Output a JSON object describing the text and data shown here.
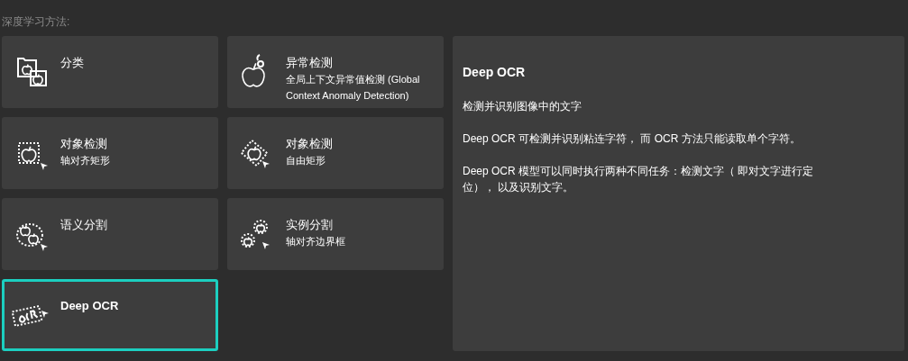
{
  "heading": "深度学习方法:",
  "methods": [
    {
      "kind": "classify",
      "title": "分类",
      "selected": false
    },
    {
      "kind": "anomaly",
      "title": "异常检测",
      "subtitle": "全局上下文异常值检测 (Global Context Anomaly Detection)",
      "selected": false
    },
    {
      "kind": "bbox",
      "title": "对象检测",
      "subtitle": "轴对齐矩形",
      "selected": false
    },
    {
      "kind": "rotated",
      "title": "对象检测",
      "subtitle": "自由矩形",
      "selected": false
    },
    {
      "kind": "semantic",
      "title": "语义分割",
      "selected": false
    },
    {
      "kind": "instance",
      "title": "实例分割",
      "subtitle": "轴对齐边界框",
      "selected": false
    },
    {
      "kind": "ocr",
      "title": "Deep OCR",
      "selected": true
    }
  ],
  "detail": {
    "title": "Deep OCR",
    "paragraphs": [
      "检测并识别图像中的文字",
      "Deep OCR 可检测并识别粘连字符， 而 OCR 方法只能读取单个字符。",
      "Deep OCR 模型可以同时执行两种不同任务：检测文字（ 即对文字进行定位）， 以及识别文字。"
    ]
  }
}
